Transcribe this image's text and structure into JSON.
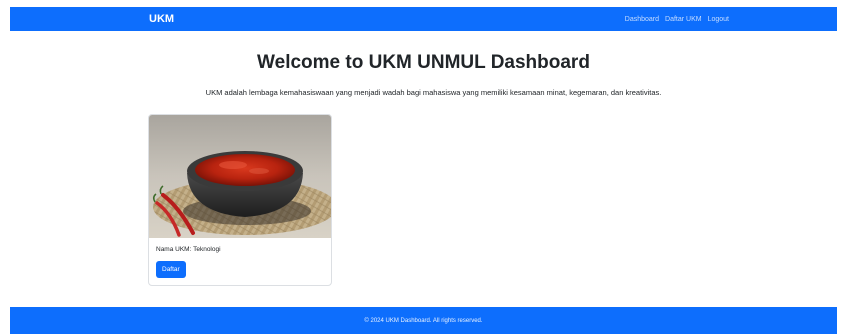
{
  "navbar": {
    "brand": "UKM",
    "links": [
      {
        "label": "Dashboard"
      },
      {
        "label": "Daftar UKM"
      },
      {
        "label": "Logout"
      }
    ]
  },
  "main": {
    "title": "Welcome to UKM UNMUL Dashboard",
    "description": "UKM adalah lembaga kemahasiswaan yang menjadi wadah bagi mahasiswa yang memiliki kesamaan minat, kegemaran, dan kreativitas."
  },
  "cards": [
    {
      "name": "Nama UKM: Teknologi",
      "button_label": "Daftar",
      "image_icon": "sambal-mortar-image"
    }
  ],
  "footer": {
    "text": "© 2024 UKM Dashboard. All rights reserved."
  },
  "colors": {
    "primary": "#0d6efd",
    "text": "#212529"
  }
}
